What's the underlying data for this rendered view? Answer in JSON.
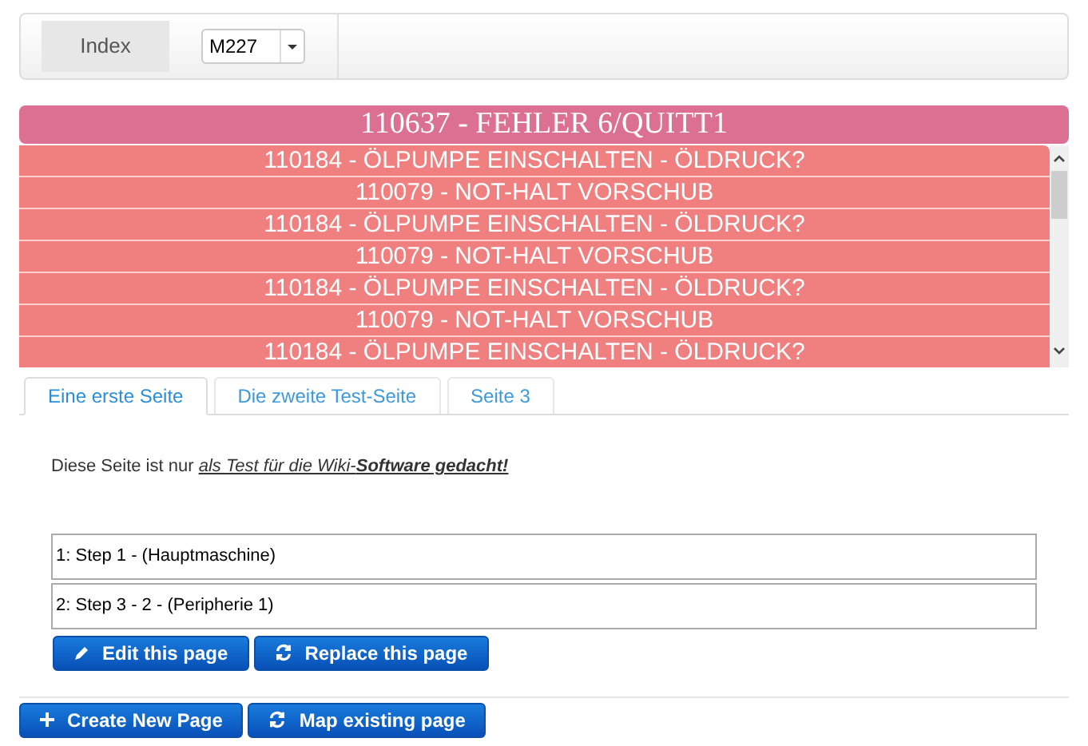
{
  "navbar": {
    "brand": "Index",
    "machine_select": {
      "value": "M227"
    }
  },
  "alarm_header": "110637 - FEHLER 6/QUITT1",
  "alarms": [
    "110184 - ÖLPUMPE EINSCHALTEN - ÖLDRUCK?",
    "110079 - NOT-HALT VORSCHUB",
    "110184 - ÖLPUMPE EINSCHALTEN - ÖLDRUCK?",
    "110079 - NOT-HALT VORSCHUB",
    "110184 - ÖLPUMPE EINSCHALTEN - ÖLDRUCK?",
    "110079 - NOT-HALT VORSCHUB",
    "110184 - ÖLPUMPE EINSCHALTEN - ÖLDRUCK?"
  ],
  "tabs": [
    {
      "label": "Eine erste Seite",
      "selected": true
    },
    {
      "label": "Die zweite Test-Seite",
      "selected": false
    },
    {
      "label": "Seite 3",
      "selected": false
    }
  ],
  "content": {
    "text": "Diese Seite ist nur ",
    "link": "als Test für die Wiki-**Software gedacht!**"
  },
  "steps": [
    "1: Step 1 - (Hauptmaschine)",
    "2: Step 3 - 2 - (Peripherie 1)"
  ],
  "page_buttons": [
    {
      "kind": "edit",
      "label": "Edit this page"
    },
    {
      "kind": "replace",
      "label": "Replace this page"
    }
  ],
  "footer_buttons": [
    {
      "kind": "create",
      "label": "Create New Page"
    },
    {
      "kind": "replace",
      "label": "Map existing page"
    }
  ]
}
